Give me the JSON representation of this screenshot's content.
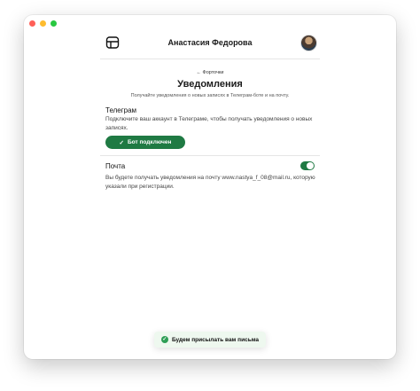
{
  "header": {
    "user_name": "Анастасия Федорова"
  },
  "page": {
    "back_link": "← Форточки",
    "title": "Уведомления",
    "subtitle": "Получайте уведомления о новых записях в Телеграм-боте и на почту."
  },
  "telegram": {
    "title": "Телеграм",
    "description": "Подключите ваш аккаунт в Телеграме, чтобы получать уведомления о новых записях.",
    "button_check": "✓",
    "button_label": "Бот подключен"
  },
  "email": {
    "title": "Почта",
    "description": "Вы будете получать уведомления на почту www.nastya_f_08@mail.ru, которую указали при регистрации.",
    "toggle_on": true
  },
  "toast": {
    "check": "✓",
    "message": "Будем присылать вам письма"
  },
  "icons": [
    "logo-icon",
    "avatar",
    "check-icon"
  ],
  "colors": {
    "accent": "#1f7a43",
    "toast_bg": "#eef8ef"
  }
}
